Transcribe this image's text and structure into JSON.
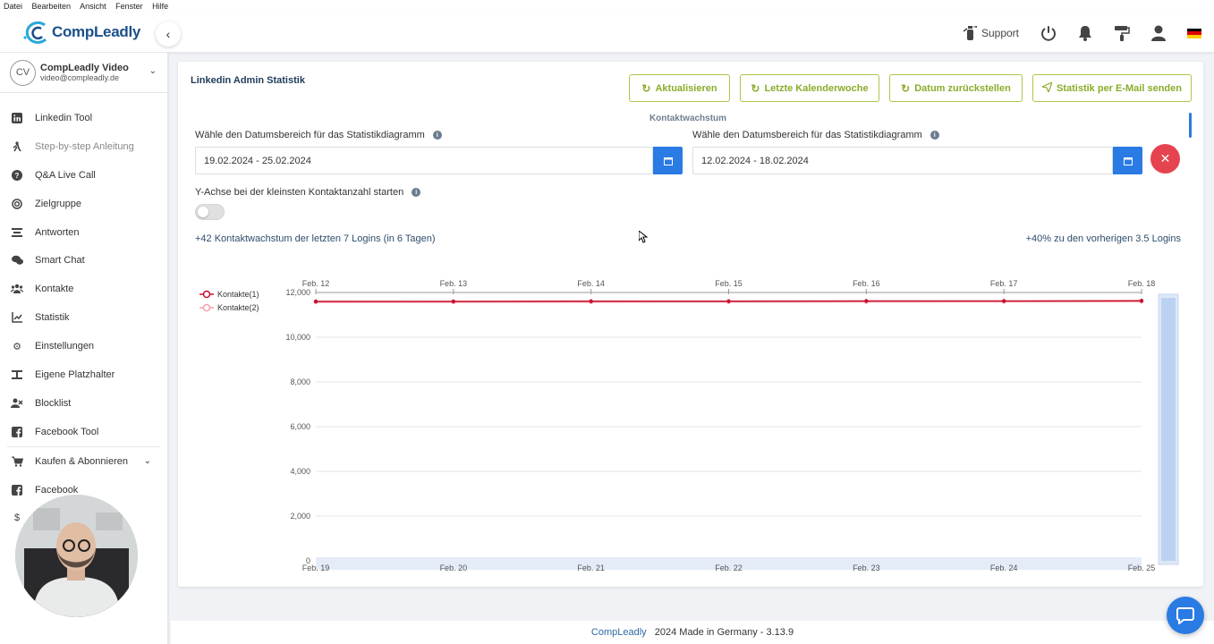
{
  "menubar": {
    "items": [
      "Datei",
      "Bearbeiten",
      "Ansicht",
      "Fenster",
      "Hilfe"
    ]
  },
  "brand": {
    "name": "CompLeadly",
    "accent": "#2a7be4",
    "logo_color": "#1b4f8a"
  },
  "header": {
    "support_label": "Support",
    "icons": [
      "power-icon",
      "bell-icon",
      "paint-roller-icon",
      "user-icon",
      "german-flag-icon"
    ]
  },
  "account": {
    "initials": "CV",
    "name": "CompLeadly Video",
    "email": "video@compleadly.de"
  },
  "sidebar": {
    "items": [
      {
        "label": "Linkedin Tool",
        "icon": "linkedin-icon"
      },
      {
        "label": "Step-by-step Anleitung",
        "icon": "walking-icon",
        "active": true
      },
      {
        "label": "Q&A Live Call",
        "icon": "question-icon"
      },
      {
        "label": "Zielgruppe",
        "icon": "target-icon"
      },
      {
        "label": "Antworten",
        "icon": "reply-icon"
      },
      {
        "label": "Smart Chat",
        "icon": "chat-icon"
      },
      {
        "label": "Kontakte",
        "icon": "users-icon"
      },
      {
        "label": "Statistik",
        "icon": "chart-icon"
      },
      {
        "label": "Einstellungen",
        "icon": "gear-icon"
      },
      {
        "label": "Eigene Platzhalter",
        "icon": "placeholder-icon"
      },
      {
        "label": "Blocklist",
        "icon": "block-icon"
      },
      {
        "label": "Facebook Tool",
        "icon": "facebook-icon"
      },
      {
        "label": "Kaufen & Abonnieren",
        "icon": "cart-icon"
      },
      {
        "label": "Facebook",
        "icon": "facebook-icon"
      }
    ],
    "partial_item_glyph": "$"
  },
  "page": {
    "title": "Linkedin Admin Statistik",
    "buttons": {
      "refresh": "Aktualisieren",
      "last_week": "Letzte Kalenderwoche",
      "reset_date": "Datum zurückstellen",
      "send_email": "Statistik per E-Mail senden"
    },
    "chart_title": "Kontaktwachstum",
    "date_label_1": "Wähle den Datumsbereich für das Statistikdiagramm",
    "date_value_1": "19.02.2024 - 25.02.2024",
    "date_label_2": "Wähle den Datumsbereich für das Statistikdiagramm",
    "date_value_2": "12.02.2024 - 18.02.2024",
    "toggle_label": "Y-Achse bei der kleinsten Kontaktanzahl starten",
    "toggle_on": false,
    "stat_left": "+42 Kontaktwachstum der letzten 7 Logins (in 6 Tagen)",
    "stat_right": "+40% zu den vorherigen 3.5 Logins"
  },
  "chart_data": {
    "type": "line",
    "title": "Kontaktwachstum",
    "x_top": [
      "Feb. 12",
      "Feb. 13",
      "Feb. 14",
      "Feb. 15",
      "Feb. 16",
      "Feb. 17",
      "Feb. 18"
    ],
    "x_bottom": [
      "Feb. 19",
      "Feb. 20",
      "Feb. 21",
      "Feb. 22",
      "Feb. 23",
      "Feb. 24",
      "Feb. 25"
    ],
    "ylim": [
      0,
      12000
    ],
    "yticks": [
      0,
      2000,
      4000,
      6000,
      8000,
      10000,
      12000
    ],
    "ytick_labels": [
      "0",
      "2,000",
      "4,000",
      "6,000",
      "8,000",
      "10,000",
      "12,000"
    ],
    "series": [
      {
        "name": "Kontakte(1)",
        "color": "#c8102e",
        "values": [
          11600,
          11600,
          11610,
          11610,
          11620,
          11620,
          11630
        ]
      },
      {
        "name": "Kontakte(2)",
        "color": "#f4a0a8",
        "values": [
          11560,
          11565,
          11570,
          11575,
          11580,
          11585,
          11590
        ]
      }
    ],
    "legend_position": "top-left"
  },
  "footer": {
    "brand": "CompLeadly",
    "text": "2024 Made in Germany - 3.13.9"
  }
}
